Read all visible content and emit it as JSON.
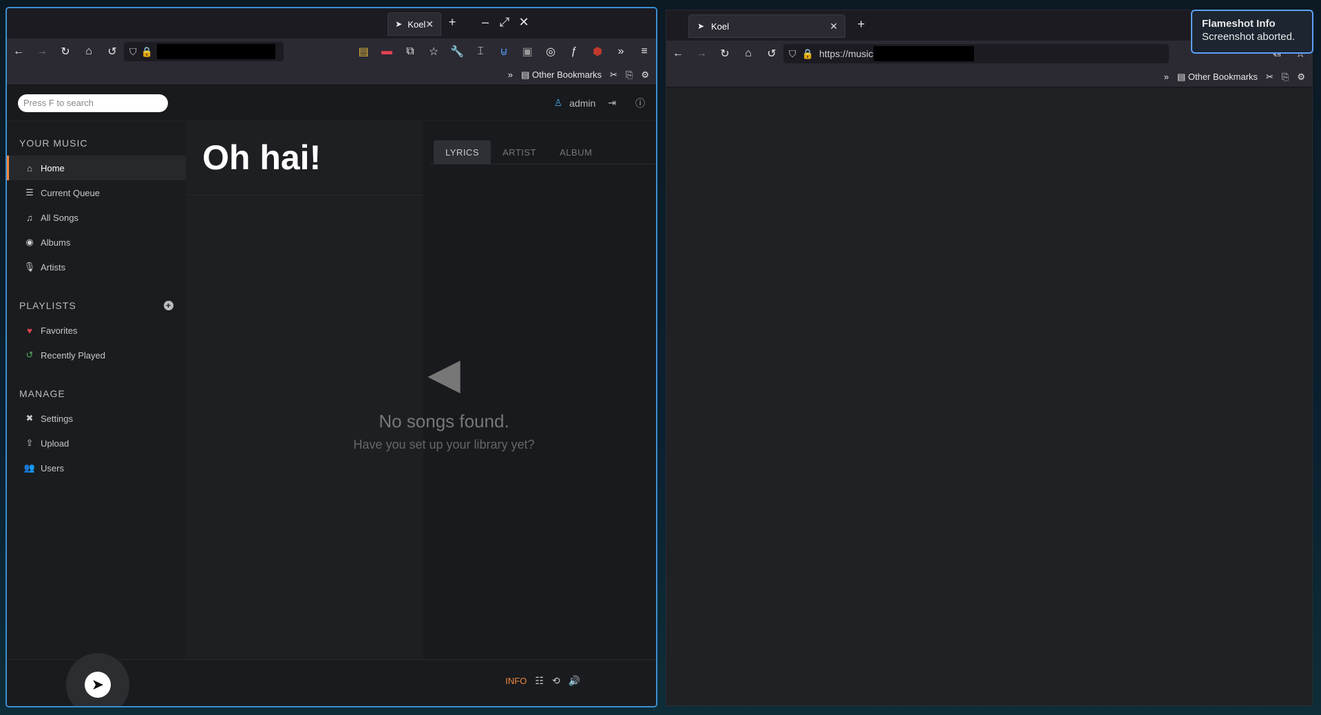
{
  "left_window": {
    "tab_title": "Koel",
    "tab_close": "✕",
    "new_tab": "+",
    "window_controls": {
      "minimize": "–",
      "maximize": "⤢",
      "close": "✕"
    },
    "nav": {
      "back": "←",
      "forward": "→",
      "reload": "↻",
      "home": "⌂",
      "history": "↺",
      "shield": "⛉",
      "menu": "≡",
      "overflow": "»"
    },
    "bookmarks": {
      "overflow": "»",
      "other_bookmarks": "Other Bookmarks"
    }
  },
  "app": {
    "search_placeholder": "Press F to search",
    "user_name": "admin",
    "sidebar": {
      "your_music_title": "YOUR MUSIC",
      "your_music_items": [
        {
          "label": "Home",
          "icon": "home-icon",
          "glyph": "⌂"
        },
        {
          "label": "Current Queue",
          "icon": "list-icon",
          "glyph": "☰"
        },
        {
          "label": "All Songs",
          "icon": "music-note-icon",
          "glyph": "♫"
        },
        {
          "label": "Albums",
          "icon": "disc-icon",
          "glyph": "◉"
        },
        {
          "label": "Artists",
          "icon": "microphone-icon",
          "glyph": "🎙"
        }
      ],
      "playlists_title": "PLAYLISTS",
      "playlists_add": "+",
      "playlist_items": [
        {
          "label": "Favorites",
          "icon": "heart-icon",
          "glyph": "♥"
        },
        {
          "label": "Recently Played",
          "icon": "history-icon",
          "glyph": "↺"
        }
      ],
      "manage_title": "MANAGE",
      "manage_items": [
        {
          "label": "Settings",
          "icon": "tools-icon",
          "glyph": "✖"
        },
        {
          "label": "Upload",
          "icon": "upload-icon",
          "glyph": "⇪"
        },
        {
          "label": "Users",
          "icon": "users-icon",
          "glyph": "👥"
        }
      ]
    },
    "main": {
      "title": "Oh hai!",
      "tabs": [
        "LYRICS",
        "ARTIST",
        "ALBUM"
      ],
      "empty_title": "No songs found.",
      "empty_subtitle": "Have you set up your library yet?"
    },
    "footer": {
      "info_label": "INFO"
    }
  },
  "right_window": {
    "tab_title": "Koel",
    "tab_close": "✕",
    "new_tab": "+",
    "url_prefix": "https://music",
    "bookmarks": {
      "overflow": "»",
      "other_bookmarks": "Other Bookmarks"
    }
  },
  "toast": {
    "title": "Flameshot Info",
    "message": "Screenshot aborted."
  },
  "colors": {
    "accent": "#f0883e",
    "favorite": "#e04050",
    "recent": "#56b35c",
    "focus_border": "#3d8fd1"
  }
}
